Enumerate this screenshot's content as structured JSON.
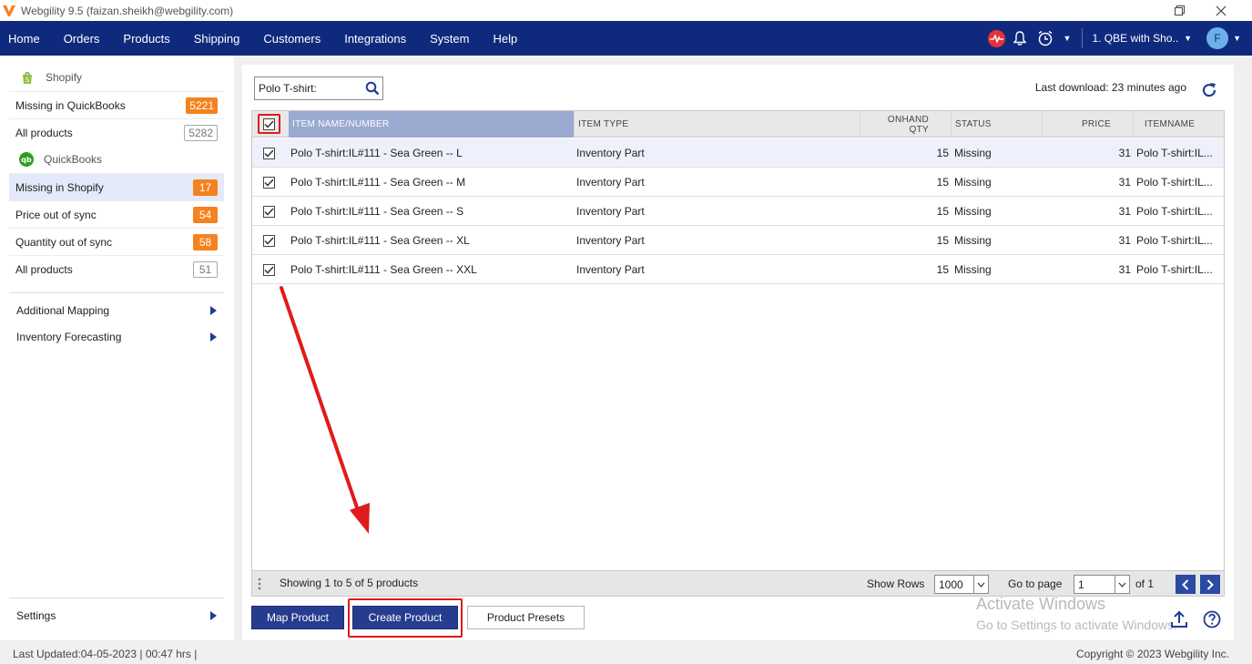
{
  "window": {
    "title": "Webgility 9.5 (faizan.sheikh@webgility.com)"
  },
  "nav": {
    "items": [
      "Home",
      "Orders",
      "Products",
      "Shipping",
      "Customers",
      "Integrations",
      "System",
      "Help"
    ],
    "company": "1. QBE with Sho..",
    "avatar_initial": "F"
  },
  "sidebar": {
    "shopify_label": "Shopify",
    "shopify_items": [
      {
        "label": "Missing in QuickBooks",
        "count": "5221"
      },
      {
        "label": "All products",
        "count": "5282"
      }
    ],
    "quickbooks_label": "QuickBooks",
    "quickbooks_items": [
      {
        "label": "Missing in Shopify",
        "count": "17"
      },
      {
        "label": "Price out of sync",
        "count": "54"
      },
      {
        "label": "Quantity out of sync",
        "count": "58"
      },
      {
        "label": "All products",
        "count": "51"
      }
    ],
    "links": [
      "Additional Mapping",
      "Inventory Forecasting"
    ],
    "settings_label": "Settings"
  },
  "main": {
    "search_value": "Polo T-shirt:",
    "last_download": "Last download: 23 minutes ago",
    "columns": {
      "name": "ITEM NAME/NUMBER",
      "type": "ITEM TYPE",
      "qty_line1": "ONHAND",
      "qty_line2": "QTY",
      "status": "STATUS",
      "price": "PRICE",
      "itemname": "ITEMNAME"
    },
    "rows": [
      {
        "name": "Polo T-shirt:IL#111 - Sea Green -- L",
        "type": "Inventory Part",
        "qty": "15",
        "status": "Missing",
        "price": "31",
        "itemname": "Polo T-shirt:IL..."
      },
      {
        "name": "Polo T-shirt:IL#111 - Sea Green -- M",
        "type": "Inventory Part",
        "qty": "15",
        "status": "Missing",
        "price": "31",
        "itemname": "Polo T-shirt:IL..."
      },
      {
        "name": "Polo T-shirt:IL#111 - Sea Green -- S",
        "type": "Inventory Part",
        "qty": "15",
        "status": "Missing",
        "price": "31",
        "itemname": "Polo T-shirt:IL..."
      },
      {
        "name": "Polo T-shirt:IL#111 - Sea Green -- XL",
        "type": "Inventory Part",
        "qty": "15",
        "status": "Missing",
        "price": "31",
        "itemname": "Polo T-shirt:IL..."
      },
      {
        "name": "Polo T-shirt:IL#111 - Sea Green -- XXL",
        "type": "Inventory Part",
        "qty": "15",
        "status": "Missing",
        "price": "31",
        "itemname": "Polo T-shirt:IL..."
      }
    ],
    "footer": {
      "showing": "Showing 1 to 5 of 5 products",
      "show_rows_label": "Show Rows",
      "show_rows_value": "1000",
      "goto_label": "Go to page",
      "goto_value": "1",
      "of_label": "of 1"
    },
    "buttons": {
      "map": "Map Product",
      "create": "Create Product",
      "presets": "Product Presets"
    },
    "watermark": {
      "line1": "Activate Windows",
      "line2": "Go to Settings to activate Windows."
    }
  },
  "status": {
    "last_updated": "Last Updated:04-05-2023 | 00:47 hrs |",
    "copyright": "Copyright © 2023 Webgility Inc."
  },
  "colors": {
    "nav_bg": "#0f2a7d",
    "accent_orange": "#f5821f",
    "primary_button": "#263d8f",
    "highlight_red": "#e01b1b"
  },
  "icons": [
    "webgility-logo-icon",
    "restore-icon",
    "close-icon",
    "pulse-icon",
    "bell-icon",
    "alarm-clock-icon",
    "chevron-down-icon",
    "shopify-bag-icon",
    "quickbooks-icon",
    "search-icon",
    "refresh-icon",
    "checkbox-checked-icon",
    "chevron-left-icon",
    "chevron-right-icon",
    "upload-icon",
    "help-icon",
    "red-arrow-annotation"
  ]
}
